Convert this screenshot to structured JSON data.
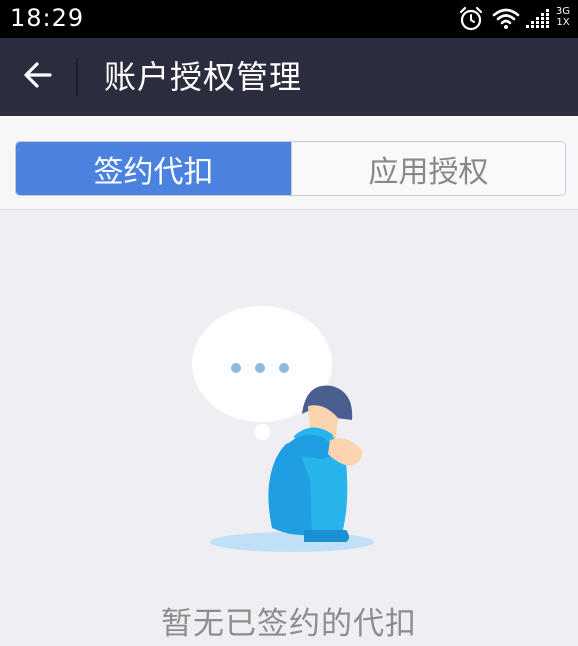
{
  "status_bar": {
    "time": "18:29",
    "network_top": "3G",
    "network_bottom": "1X",
    "icons": [
      "alarm-icon",
      "wifi-icon",
      "signal-icon"
    ]
  },
  "nav": {
    "title": "账户授权管理",
    "back_icon": "arrow-left-icon"
  },
  "tabs": [
    {
      "label": "签约代扣",
      "active": true
    },
    {
      "label": "应用授权",
      "active": false
    }
  ],
  "empty_state": {
    "message": "暂无已签约的代扣",
    "illustration": "sad-person-thought-bubble"
  },
  "colors": {
    "status_bar_bg": "#000000",
    "nav_bg": "#2b2c3e",
    "tab_active_bg": "#4b82e0",
    "tab_inactive_text": "#888889",
    "page_bg": "#efeff3",
    "empty_text": "#8d8d8f",
    "illustration_blue": "#1f9ee4"
  }
}
